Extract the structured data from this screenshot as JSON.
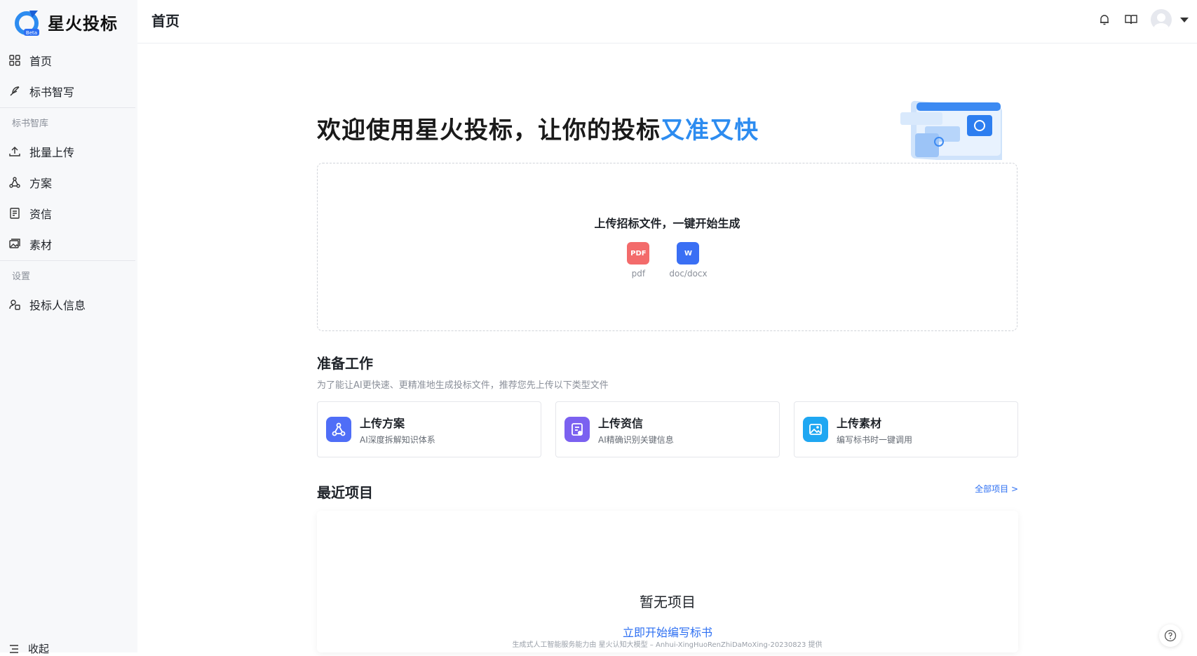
{
  "app": {
    "name": "星火投标",
    "badge": "Beta"
  },
  "sidebar": {
    "items_top": [
      {
        "label": "首页",
        "icon": "grid-icon"
      },
      {
        "label": "标书智写",
        "icon": "feather-icon"
      }
    ],
    "group1": "标书智库",
    "items_lib": [
      {
        "label": "批量上传",
        "icon": "upload-icon"
      },
      {
        "label": "方案",
        "icon": "nodes-icon"
      },
      {
        "label": "资信",
        "icon": "doc-icon"
      },
      {
        "label": "素材",
        "icon": "images-icon"
      }
    ],
    "group2": "设置",
    "items_settings": [
      {
        "label": "投标人信息",
        "icon": "user-info-icon"
      }
    ],
    "collapse_label": "收起"
  },
  "header": {
    "title": "首页"
  },
  "hero": {
    "text": "欢迎使用星火投标，让你的投标",
    "accent": "又准又快"
  },
  "upload": {
    "title": "上传招标文件，一键开始生成",
    "types": [
      {
        "label": "pdf",
        "glyph": "PDF"
      },
      {
        "label": "doc/docx",
        "glyph": "W"
      }
    ]
  },
  "prepare": {
    "title": "准备工作",
    "subtitle": "为了能让AI更快速、更精准地生成投标文件，推荐您先上传以下类型文件",
    "cards": [
      {
        "title": "上传方案",
        "desc": "AI深度拆解知识体系",
        "color": "#4f6ef7"
      },
      {
        "title": "上传资信",
        "desc": "AI精确识别关键信息",
        "color": "#7b61f0"
      },
      {
        "title": "上传素材",
        "desc": "编写标书时一键调用",
        "color": "#1fa7f2"
      }
    ]
  },
  "recent": {
    "title": "最近项目",
    "all_link": "全部项目 >",
    "empty": "暂无项目",
    "empty_action": "立即开始编写标书"
  },
  "footer": {
    "text": "生成式人工智能服务能力由 星火认知大模型 – Anhui-XingHuoRenZhiDaMoXing-20230823 提供"
  },
  "colors": {
    "accent": "#2d8cf0",
    "link": "#2d6ff2"
  }
}
